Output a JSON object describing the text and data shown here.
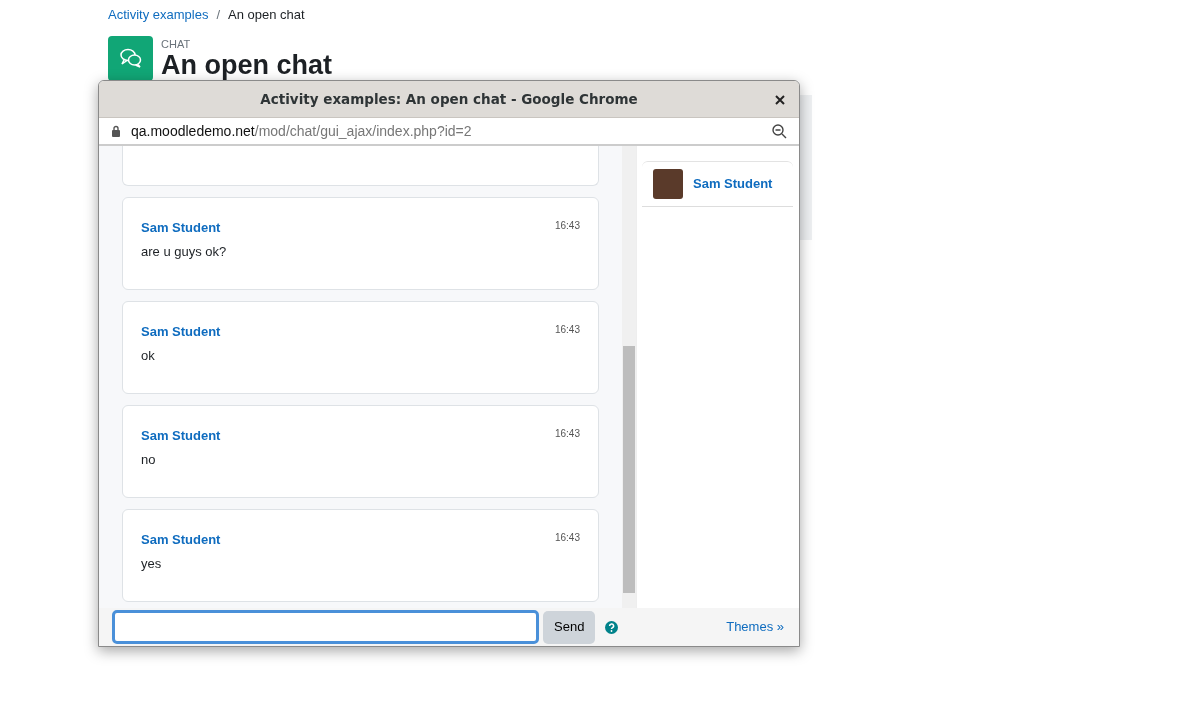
{
  "breadcrumb": [
    {
      "label": "Activity examples",
      "kind": "link"
    },
    {
      "label": "/",
      "kind": "separator"
    },
    {
      "label": "An open chat",
      "kind": "current"
    }
  ],
  "page_header": {
    "type_label": "CHAT",
    "title": "An open chat"
  },
  "popup_window": {
    "title": "Activity examples: An open chat - Google Chrome",
    "url_host": "qa.moodledemo.net",
    "url_path": "/mod/chat/gui_ajax/index.php?id=2"
  },
  "messages": [
    {
      "author": "Sam Student",
      "time": "16:43",
      "text": "are u guys ok?"
    },
    {
      "author": "Sam Student",
      "time": "16:43",
      "text": "ok"
    },
    {
      "author": "Sam Student",
      "time": "16:43",
      "text": "no"
    },
    {
      "author": "Sam Student",
      "time": "16:43",
      "text": "yes"
    }
  ],
  "users": [
    {
      "name": "Sam Student"
    }
  ],
  "composer": {
    "send_label": "Send",
    "themes_label": "Themes »"
  }
}
